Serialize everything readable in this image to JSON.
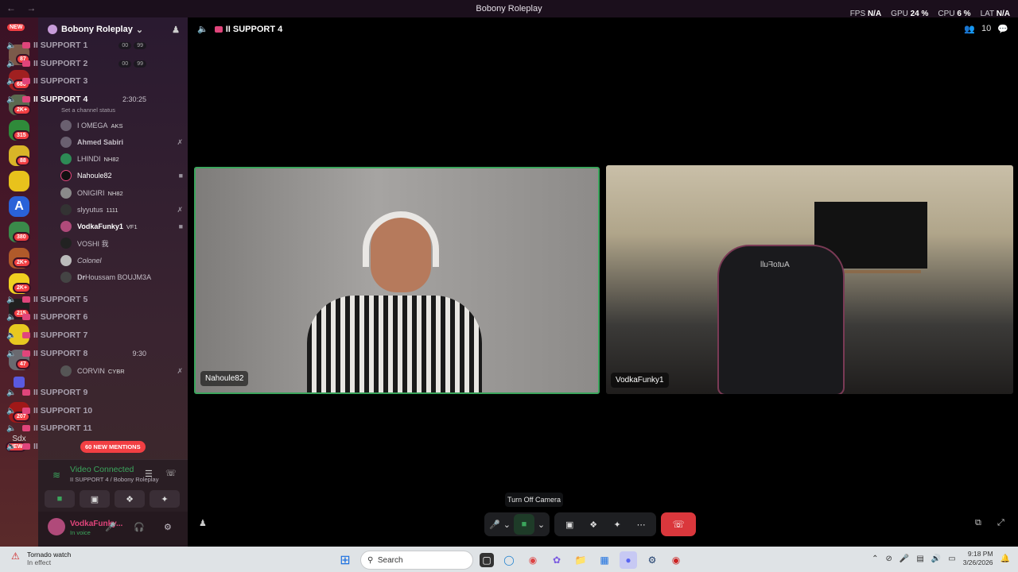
{
  "window": {
    "title": "Bobony Roleplay",
    "nav_back": "←",
    "nav_forward": "→",
    "stats": [
      {
        "label": "FPS",
        "value": "N/A"
      },
      {
        "label": "GPU",
        "value": "24 %"
      },
      {
        "label": "CPU",
        "value": "6 %"
      },
      {
        "label": "LAT",
        "value": "N/A"
      }
    ]
  },
  "servers": {
    "badges": [
      "NEW",
      "87",
      "680",
      "2K+",
      "315",
      "88",
      "380",
      "2K+",
      "2K+",
      "215",
      "47",
      "207",
      "NEW"
    ],
    "text_server": "Sdx"
  },
  "guild": {
    "name": "Bobony Roleplay"
  },
  "channels": [
    {
      "name": "SUPPORT 1",
      "pills": [
        "00",
        "99"
      ]
    },
    {
      "name": "SUPPORT 2",
      "pills": [
        "00",
        "99"
      ]
    },
    {
      "name": "SUPPORT 3"
    },
    {
      "name": "SUPPORT 4",
      "time": "2:30:25",
      "active": true
    },
    {
      "name": "SUPPORT 5"
    },
    {
      "name": "SUPPORT 6"
    },
    {
      "name": "SUPPORT 7"
    },
    {
      "name": "SUPPORT 8",
      "time": "9:30"
    },
    {
      "name": "SUPPORT 9"
    },
    {
      "name": "SUPPORT 10"
    },
    {
      "name": "SUPPORT 11"
    }
  ],
  "channel_prefix": "II",
  "channel_status_hint": "Set a channel status",
  "members_support4": [
    {
      "name": "I OMEGA",
      "extra": "AKS"
    },
    {
      "name": "Ahmed Sabiri"
    },
    {
      "name": "LHINDI",
      "extra": "NH82"
    },
    {
      "name": "Nahoule82"
    },
    {
      "name": "ONIGIRI",
      "extra": "NH82"
    },
    {
      "name": "slyyutus",
      "extra": "1111"
    },
    {
      "name": "VodkaFunky1",
      "extra": "VF1"
    },
    {
      "name": "VOSHI 我"
    },
    {
      "name": "Colonel"
    },
    {
      "name": "𝐃𝐫Houssam BOUJM3A"
    }
  ],
  "members_support8": [
    {
      "name": "CORVIN",
      "extra": "CYBR"
    }
  ],
  "mentions": "60 NEW MENTIONS",
  "voice": {
    "status": "Video Connected",
    "location": "II SUPPORT 4 / Bobony Roleplay"
  },
  "user": {
    "name": "VodkaFunky...",
    "status": "In voice"
  },
  "stage": {
    "channel_name": "II SUPPORT 4",
    "participant_count": "10",
    "tiles": [
      {
        "name": "Nahoule82"
      },
      {
        "name": "VodkaFunky1"
      }
    ],
    "chair_text": "AutoFull",
    "tooltip": "Turn Off Camera"
  },
  "taskbar": {
    "weather_title": "Tornado watch",
    "weather_sub": "In effect",
    "search_placeholder": "Search",
    "time": "9:18 PM",
    "date": "3/26/2026"
  },
  "colors": {
    "accent_green": "#3ba55c",
    "danger": "#da373c",
    "mention_red": "#f23f43",
    "channel_tag": "#e0457b"
  }
}
